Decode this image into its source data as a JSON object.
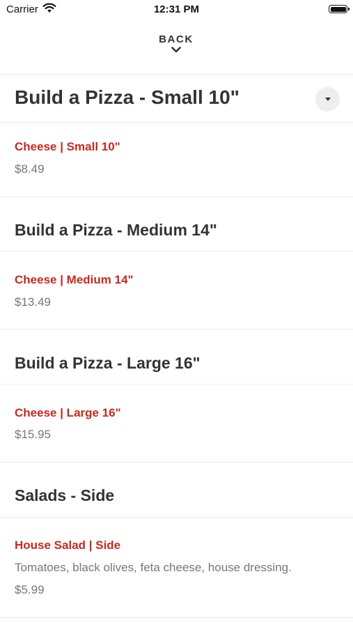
{
  "status_bar": {
    "carrier": "Carrier",
    "time": "12:31 PM"
  },
  "nav": {
    "back_label": "BACK"
  },
  "sections": [
    {
      "title": "Build a Pizza - Small 10\"",
      "items": [
        {
          "name": "Cheese | Small 10\"",
          "price": "$8.49"
        }
      ]
    },
    {
      "title": "Build a Pizza - Medium 14\"",
      "items": [
        {
          "name": "Cheese | Medium 14\"",
          "price": "$13.49"
        }
      ]
    },
    {
      "title": "Build a Pizza - Large 16\"",
      "items": [
        {
          "name": "Cheese | Large 16\"",
          "price": "$15.95"
        }
      ]
    },
    {
      "title": "Salads - Side",
      "items": [
        {
          "name": "House Salad | Side",
          "description": "Tomatoes, black olives, feta cheese, house dressing.",
          "price": "$5.99"
        }
      ]
    }
  ],
  "icons": {
    "wifi": "wifi-icon",
    "battery": "battery-icon",
    "back": "chevron-down-icon",
    "dropdown": "caret-down-icon"
  },
  "colors": {
    "item_name": "#c8281e",
    "title": "#333333",
    "price": "#777777",
    "divider": "#ececec"
  }
}
